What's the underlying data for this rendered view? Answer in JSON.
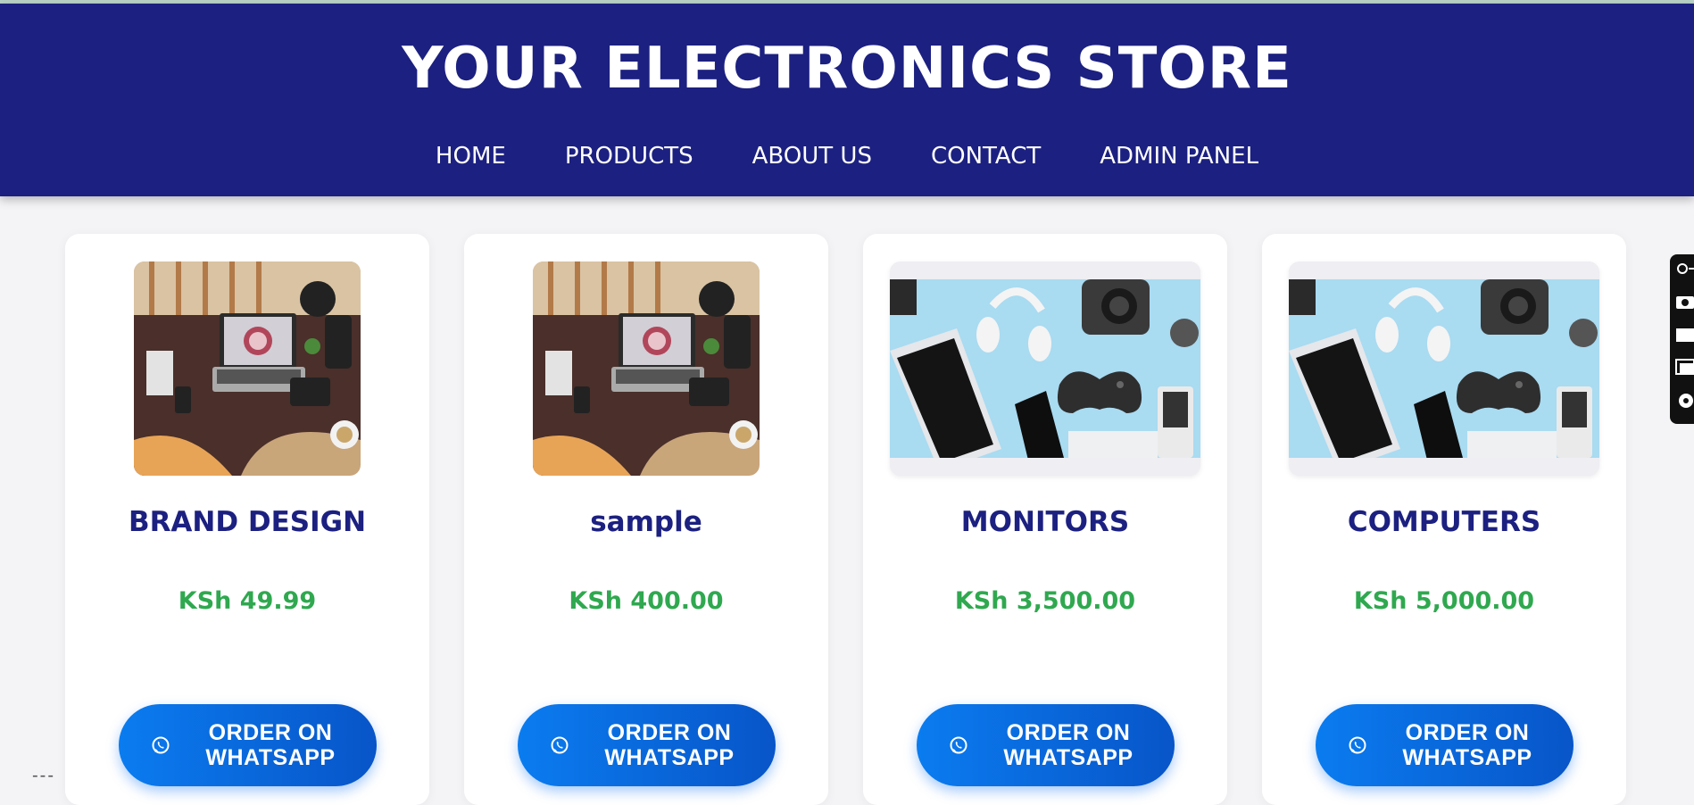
{
  "header": {
    "title": "YOUR ELECTRONICS STORE",
    "nav": [
      "HOME",
      "PRODUCTS",
      "ABOUT US",
      "CONTACT",
      "ADMIN PANEL"
    ]
  },
  "products": [
    {
      "name": "BRAND DESIGN",
      "price": "KSh 49.99",
      "image": "desk-workspace",
      "button": "ORDER ON WHATSAPP"
    },
    {
      "name": "sample",
      "price": "KSh 400.00",
      "image": "desk-workspace",
      "button": "ORDER ON WHATSAPP"
    },
    {
      "name": "MONITORS",
      "price": "KSh 3,500.00",
      "image": "gadgets-flatlay",
      "button": "ORDER ON WHATSAPP"
    },
    {
      "name": "COMPUTERS",
      "price": "KSh 5,000.00",
      "image": "gadgets-flatlay",
      "button": "ORDER ON WHATSAPP"
    }
  ],
  "footer_dashes": "---",
  "colors": {
    "header_bg": "#1c2080",
    "price": "#2fa84f",
    "button": "#0a7cf0",
    "title": "#1c2080"
  }
}
